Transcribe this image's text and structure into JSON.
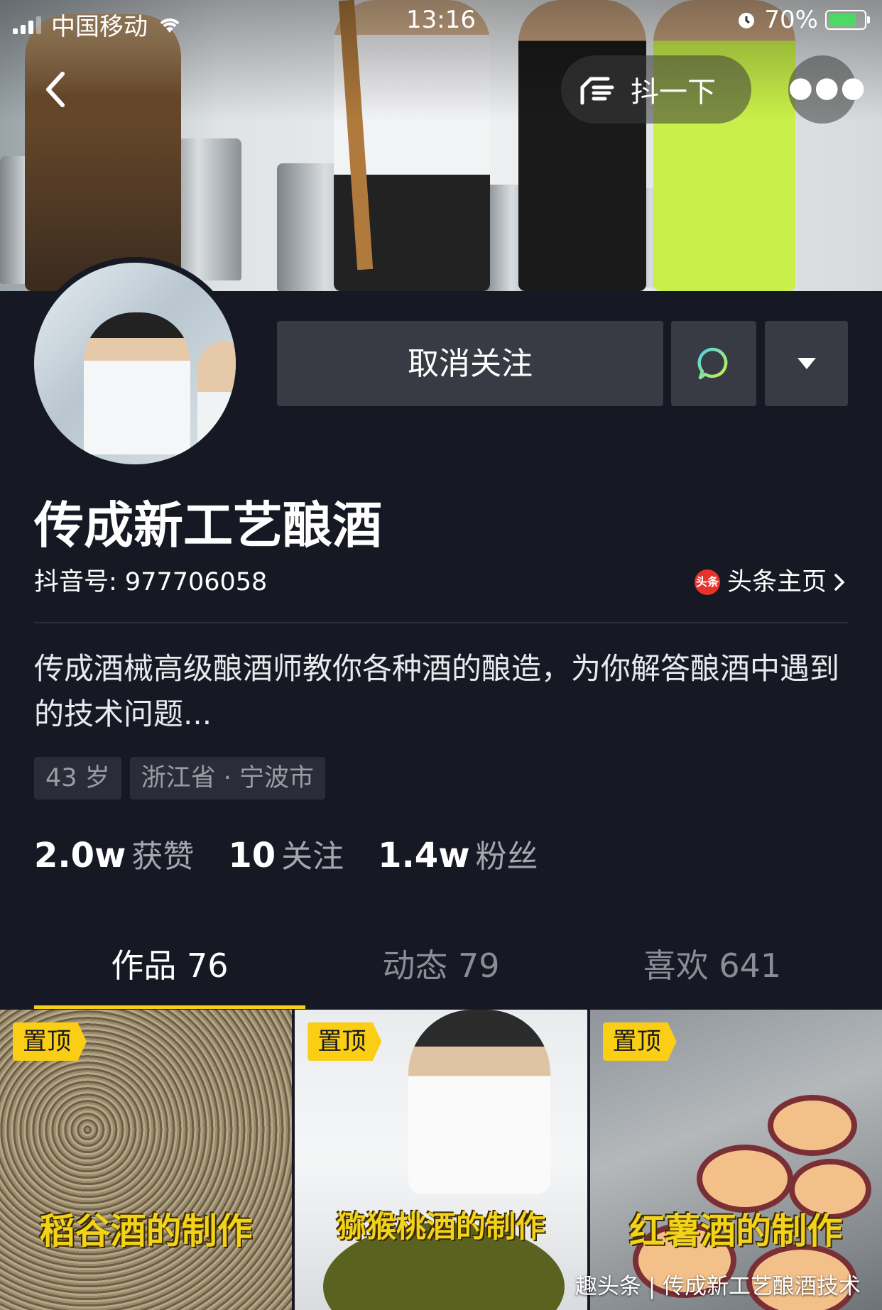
{
  "status_bar": {
    "carrier": "中国移动",
    "time": "13:16",
    "battery_percent": "70%",
    "battery_level": 0.7
  },
  "nav": {
    "shake_label": "抖一下"
  },
  "profile": {
    "unfollow_label": "取消关注",
    "name": "传成新工艺酿酒",
    "douyin_id": "抖音号: 977706058",
    "toutiao_logo_text": "头条",
    "toutiao_link": "头条主页",
    "bio": "传成酒械高级酿酒师教你各种酒的酿造，为你解答酿酒中遇到的技术问题...",
    "tags": [
      "43 岁",
      "浙江省 · 宁波市"
    ],
    "stats": [
      {
        "value": "2.0w",
        "label": "获赞"
      },
      {
        "value": "10",
        "label": "关注"
      },
      {
        "value": "1.4w",
        "label": "粉丝"
      }
    ]
  },
  "tabs": [
    {
      "label": "作品 76"
    },
    {
      "label": "动态 79"
    },
    {
      "label": "喜欢 641"
    }
  ],
  "videos": [
    {
      "pin": "置顶",
      "caption": "稻谷酒的制作"
    },
    {
      "pin": "置顶",
      "caption": "猕猴桃酒的制作"
    },
    {
      "pin": "置顶",
      "caption": "红薯酒的制作"
    }
  ],
  "watermark": "趣头条 | 传成新工艺酿酒技术",
  "colors": {
    "background": "#161823",
    "accent": "#face15",
    "button": "#393b44"
  }
}
